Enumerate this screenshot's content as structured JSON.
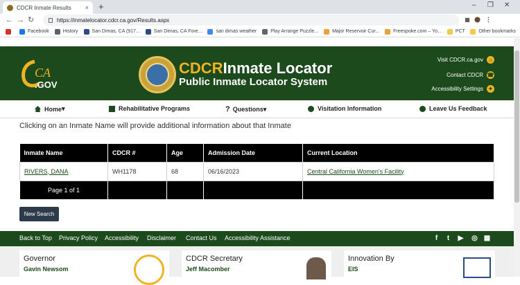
{
  "browser": {
    "tab_title": "CDCR Inmate Results",
    "tab_close": "×",
    "new_tab": "+",
    "url": "https://inmatelocator.cdcr.ca.gov/Results.aspx",
    "window_controls": {
      "minimize": "–",
      "restore": "❐",
      "close": "✕"
    },
    "bookmarks": [
      {
        "label": "Facebook",
        "color": "#1877f2"
      },
      {
        "label": "History",
        "color": "#5f6368"
      },
      {
        "label": "San Dimas, CA (917...",
        "color": "#2b4a8a"
      },
      {
        "label": "San Dimas, CA Fore...",
        "color": "#2b4a8a"
      },
      {
        "label": "san dimas weather",
        "color": "#4285f4"
      },
      {
        "label": "Play Arrange Puzzle...",
        "color": "#666666"
      },
      {
        "label": "Major Reservoir Cur...",
        "color": "#e8a33d"
      },
      {
        "label": "Freespoke.com – Yo...",
        "color": "#e8a33d"
      },
      {
        "label": "PCT",
        "color": "#f2c94c"
      }
    ],
    "other_bookmarks": "Other bookmarks"
  },
  "header": {
    "logo_ca": "CA",
    "logo_gov": ".GOV",
    "brand_cdcr": "CDCR",
    "brand_title": "Inmate Locator",
    "brand_subtitle": "Public Inmate Locator System",
    "visit_link": "Visit CDCR.ca.gov",
    "contact_link": "Contact CDCR",
    "accessibility_link": "Accessibility Settings",
    "brand_color": "#1c4a1c",
    "accent_color": "#f0b323"
  },
  "nav": {
    "home": "Home",
    "programs": "Rehabilitative Programs",
    "questions": "Questions",
    "visitation": "Visitation Information",
    "feedback": "Leave Us Feedback"
  },
  "main": {
    "intro": "Clicking on an Inmate Name will provide additional information about that Inmate",
    "columns": [
      "Inmate Name",
      "CDCR #",
      "Age",
      "Admission Date",
      "Current Location"
    ],
    "rows": [
      {
        "name": "RIVERS, DANA",
        "cdcr": "WH1178",
        "age": "68",
        "admission": "06/16/2023",
        "location": "Central California Women's Facility"
      }
    ],
    "pager": "Page 1 of 1",
    "new_search": "New Search"
  },
  "footer": {
    "links": [
      "Back to Top",
      "Privacy Policy",
      "Accessibility",
      "Disclaimer",
      "Contact Us",
      "Accessibility Assistance"
    ],
    "social": [
      "facebook",
      "twitter",
      "youtube",
      "instagram",
      "flickr"
    ],
    "cards": [
      {
        "title": "Governor",
        "name": "Gavin Newsom"
      },
      {
        "title": "CDCR Secretary",
        "name": "Jeff Macomber"
      },
      {
        "title": "Innovation By",
        "name": "EIS"
      }
    ]
  }
}
